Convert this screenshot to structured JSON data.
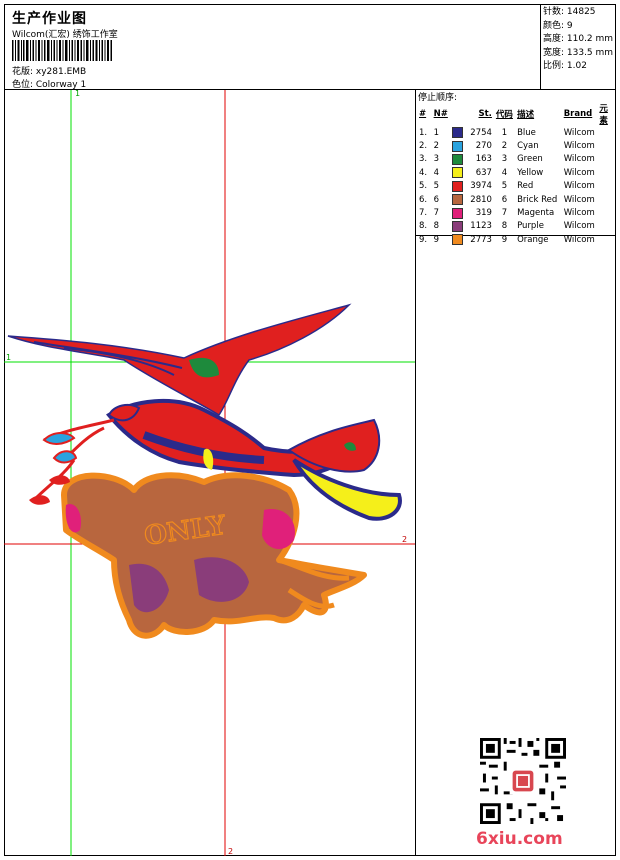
{
  "header": {
    "title": "生产作业图",
    "subtitle": "Wilcom(汇宏) 绣饰工作室",
    "design_label": "花版: xy281.EMB",
    "colorway_label": "色位: Colorway 1"
  },
  "stats": {
    "stitches": "针数: 14825",
    "colors": "颜色: 9",
    "height": "高度: 110.2 mm",
    "width": "宽度: 133.5 mm",
    "ratio": "比例: 1.02"
  },
  "stop_sequence": {
    "title": "停止顺序:",
    "headers": [
      "#",
      "N#",
      "St.",
      "代码",
      "描述",
      "Brand",
      "元素"
    ],
    "rows": [
      {
        "idx": "1.",
        "n": "1",
        "st": "2754",
        "code": "1",
        "desc": "Blue",
        "brand": "Wilcom",
        "color": "#2b2a8a"
      },
      {
        "idx": "2.",
        "n": "2",
        "st": "270",
        "code": "2",
        "desc": "Cyan",
        "brand": "Wilcom",
        "color": "#2aa3df"
      },
      {
        "idx": "3.",
        "n": "3",
        "st": "163",
        "code": "3",
        "desc": "Green",
        "brand": "Wilcom",
        "color": "#1e8a3c"
      },
      {
        "idx": "4.",
        "n": "4",
        "st": "637",
        "code": "4",
        "desc": "Yellow",
        "brand": "Wilcom",
        "color": "#f5ef1a"
      },
      {
        "idx": "5.",
        "n": "5",
        "st": "3974",
        "code": "5",
        "desc": "Red",
        "brand": "Wilcom",
        "color": "#e0201f"
      },
      {
        "idx": "6.",
        "n": "6",
        "st": "2810",
        "code": "6",
        "desc": "Brick Red",
        "brand": "Wilcom",
        "color": "#b8663e"
      },
      {
        "idx": "7.",
        "n": "7",
        "st": "319",
        "code": "7",
        "desc": "Magenta",
        "brand": "Wilcom",
        "color": "#e0207a"
      },
      {
        "idx": "8.",
        "n": "8",
        "st": "1123",
        "code": "8",
        "desc": "Purple",
        "brand": "Wilcom",
        "color": "#8a3d7a"
      },
      {
        "idx": "9.",
        "n": "9",
        "st": "2773",
        "code": "9",
        "desc": "Orange",
        "brand": "Wilcom",
        "color": "#f08a1e"
      }
    ]
  },
  "guides": {
    "v1": "1",
    "v2": "2",
    "h1": "1",
    "h2": "2"
  },
  "watermark": "6xiu.com"
}
